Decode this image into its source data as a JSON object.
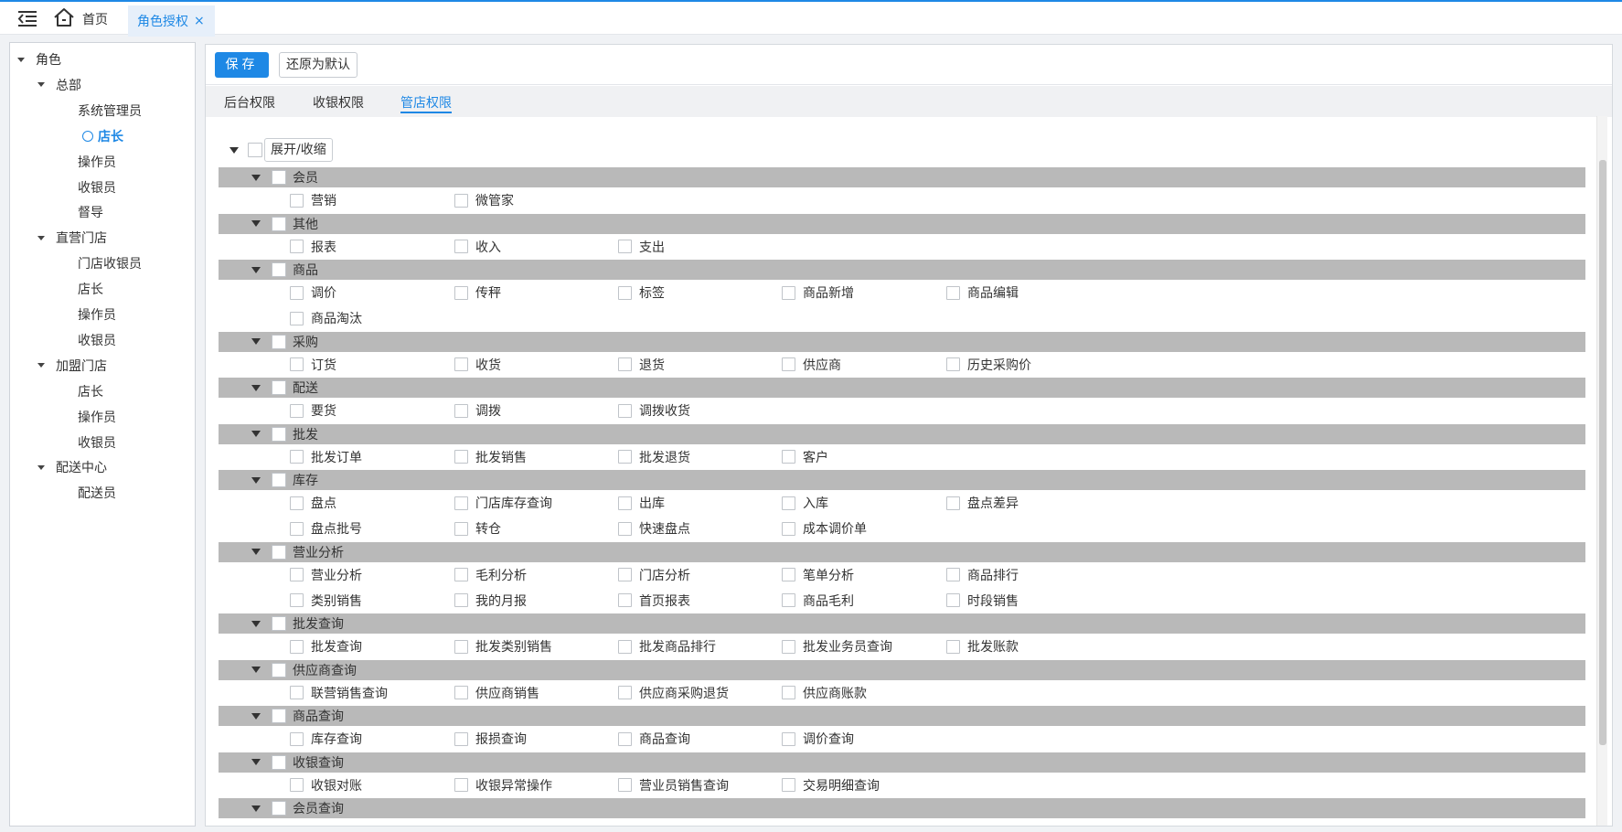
{
  "topbar": {
    "home_label": "首页",
    "active_tab_label": "角色授权",
    "close_glyph": "×"
  },
  "sidebar": {
    "nodes": [
      {
        "label": "角色",
        "level": 0,
        "expanded": true
      },
      {
        "label": "总部",
        "level": 1,
        "expanded": true
      },
      {
        "label": "系统管理员",
        "level": 2
      },
      {
        "label": "店长",
        "level": 2,
        "selected": true
      },
      {
        "label": "操作员",
        "level": 2
      },
      {
        "label": "收银员",
        "level": 2
      },
      {
        "label": "督导",
        "level": 2
      },
      {
        "label": "直营门店",
        "level": 1,
        "expanded": true
      },
      {
        "label": "门店收银员",
        "level": 2
      },
      {
        "label": "店长",
        "level": 2
      },
      {
        "label": "操作员",
        "level": 2
      },
      {
        "label": "收银员",
        "level": 2
      },
      {
        "label": "加盟门店",
        "level": 1,
        "expanded": true
      },
      {
        "label": "店长",
        "level": 2
      },
      {
        "label": "操作员",
        "level": 2
      },
      {
        "label": "收银员",
        "level": 2
      },
      {
        "label": "配送中心",
        "level": 1,
        "expanded": true
      },
      {
        "label": "配送员",
        "level": 2
      }
    ]
  },
  "toolbar": {
    "save_label": "保存",
    "reset_label": "还原为默认"
  },
  "subtabs": [
    {
      "label": "后台权限",
      "active": false
    },
    {
      "label": "收银权限",
      "active": false
    },
    {
      "label": "管店权限",
      "active": true
    }
  ],
  "permissions": {
    "toggle_label": "展开/收缩",
    "groups": [
      {
        "name": "会员",
        "items": [
          "营销",
          "微管家"
        ]
      },
      {
        "name": "其他",
        "items": [
          "报表",
          "收入",
          "支出"
        ]
      },
      {
        "name": "商品",
        "items": [
          "调价",
          "传秤",
          "标签",
          "商品新增",
          "商品编辑",
          "商品淘汰"
        ]
      },
      {
        "name": "采购",
        "items": [
          "订货",
          "收货",
          "退货",
          "供应商",
          "历史采购价"
        ]
      },
      {
        "name": "配送",
        "items": [
          "要货",
          "调拨",
          "调拨收货"
        ]
      },
      {
        "name": "批发",
        "items": [
          "批发订单",
          "批发销售",
          "批发退货",
          "客户"
        ]
      },
      {
        "name": "库存",
        "items": [
          "盘点",
          "门店库存查询",
          "出库",
          "入库",
          "盘点差异",
          "盘点批号",
          "转仓",
          "快速盘点",
          "成本调价单"
        ]
      },
      {
        "name": "营业分析",
        "items": [
          "营业分析",
          "毛利分析",
          "门店分析",
          "笔单分析",
          "商品排行",
          "类别销售",
          "我的月报",
          "首页报表",
          "商品毛利",
          "时段销售"
        ]
      },
      {
        "name": "批发查询",
        "items": [
          "批发查询",
          "批发类别销售",
          "批发商品排行",
          "批发业务员查询",
          "批发账款"
        ]
      },
      {
        "name": "供应商查询",
        "items": [
          "联营销售查询",
          "供应商销售",
          "供应商采购退货",
          "供应商账款"
        ]
      },
      {
        "name": "商品查询",
        "items": [
          "库存查询",
          "报损查询",
          "商品查询",
          "调价查询"
        ]
      },
      {
        "name": "收银查询",
        "items": [
          "收银对账",
          "收银异常操作",
          "营业员销售查询",
          "交易明细查询"
        ]
      },
      {
        "name": "会员查询",
        "items": []
      }
    ]
  }
}
